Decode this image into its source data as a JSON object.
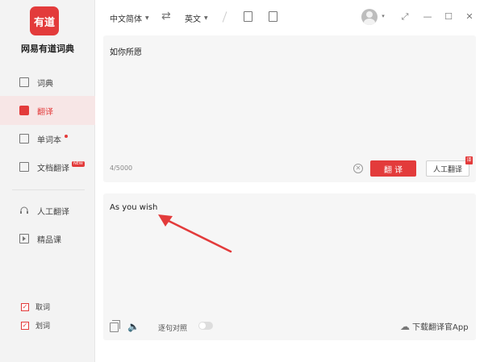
{
  "app": {
    "logo_text": "有道",
    "name": "网易有道词典"
  },
  "sidebar": {
    "items": [
      {
        "label": "词典"
      },
      {
        "label": "翻译"
      },
      {
        "label": "单词本"
      },
      {
        "label": "文档翻译",
        "badge": "NEW"
      },
      {
        "label": "人工翻译"
      },
      {
        "label": "精品课"
      }
    ],
    "checkboxes": [
      {
        "label": "取词",
        "checked": true
      },
      {
        "label": "划词",
        "checked": true
      }
    ]
  },
  "topbar": {
    "source_lang": "中文简体",
    "target_lang": "英文",
    "swap_icon": "swap-arrows-icon"
  },
  "input": {
    "text": "如你所愿",
    "char_count": "4/5000",
    "translate_label": "翻 译",
    "human_translate_label": "人工翻译",
    "human_badge": "译"
  },
  "output": {
    "text": "As you wish",
    "compare_label": "逐句对照",
    "download_label": "下载翻译官App"
  },
  "colors": {
    "accent": "#e33b3b",
    "panel_bg": "#f6f6f6",
    "sidebar_bg": "#f3f3f3"
  }
}
